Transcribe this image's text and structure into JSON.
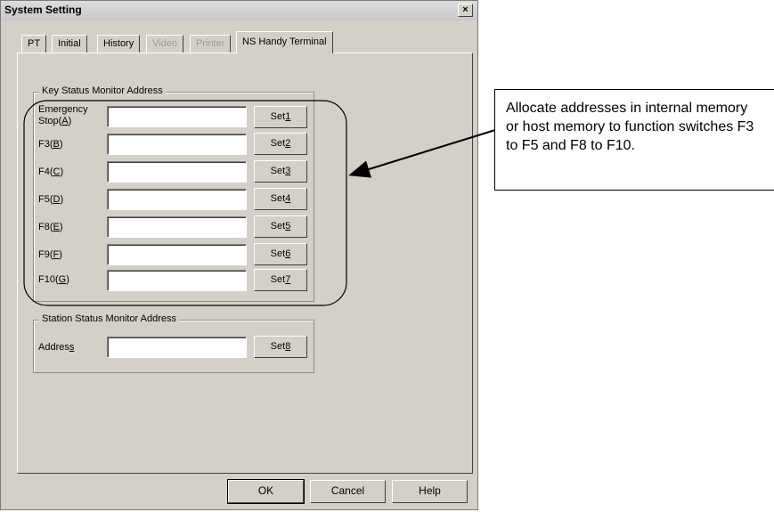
{
  "window": {
    "title": "System Setting",
    "close_label": "×"
  },
  "tabs": [
    {
      "label": "PT",
      "state": "normal"
    },
    {
      "label": "Initial",
      "state": "normal"
    },
    {
      "label": "History",
      "state": "normal"
    },
    {
      "label": "Video",
      "state": "disabled"
    },
    {
      "label": "Printer",
      "state": "disabled"
    },
    {
      "label": "NS Handy Terminal",
      "state": "active"
    }
  ],
  "key_status": {
    "legend": "Key Status Monitor Address",
    "rows": [
      {
        "label_line1": "Emergency",
        "label_prefix": "Stop(",
        "label_key": "A",
        "label_suffix": ")",
        "value": "",
        "button_prefix": "Set",
        "button_key": "1"
      },
      {
        "label_prefix": "F3(",
        "label_key": "B",
        "label_suffix": ")",
        "value": "",
        "button_prefix": "Set",
        "button_key": "2"
      },
      {
        "label_prefix": "F4(",
        "label_key": "C",
        "label_suffix": ")",
        "value": "",
        "button_prefix": "Set",
        "button_key": "3"
      },
      {
        "label_prefix": "F5(",
        "label_key": "D",
        "label_suffix": ")",
        "value": "",
        "button_prefix": "Set",
        "button_key": "4"
      },
      {
        "label_prefix": "F8(",
        "label_key": "E",
        "label_suffix": ")",
        "value": "",
        "button_prefix": "Set",
        "button_key": "5"
      },
      {
        "label_prefix": "F9(",
        "label_key": "F",
        "label_suffix": ")",
        "value": "",
        "button_prefix": "Set",
        "button_key": "6"
      },
      {
        "label_prefix": "F10(",
        "label_key": "G",
        "label_suffix": ")",
        "value": "",
        "button_prefix": "Set",
        "button_key": "7"
      }
    ]
  },
  "station_status": {
    "legend": "Station Status Monitor Address",
    "label_prefix": "Addres",
    "label_key": "s",
    "label_suffix": "",
    "value": "",
    "button_prefix": "Set",
    "button_key": "8"
  },
  "footer": {
    "ok_label": "OK",
    "cancel_label": "Cancel",
    "help_label": "Help"
  },
  "callout": {
    "text": "Allocate addresses in internal memory or host memory to function switches F3 to F5 and F8 to F10."
  },
  "colors": {
    "dialog_bg": "#d4d0c8",
    "page_bg": "#ffffff",
    "annotation": "#000000"
  }
}
